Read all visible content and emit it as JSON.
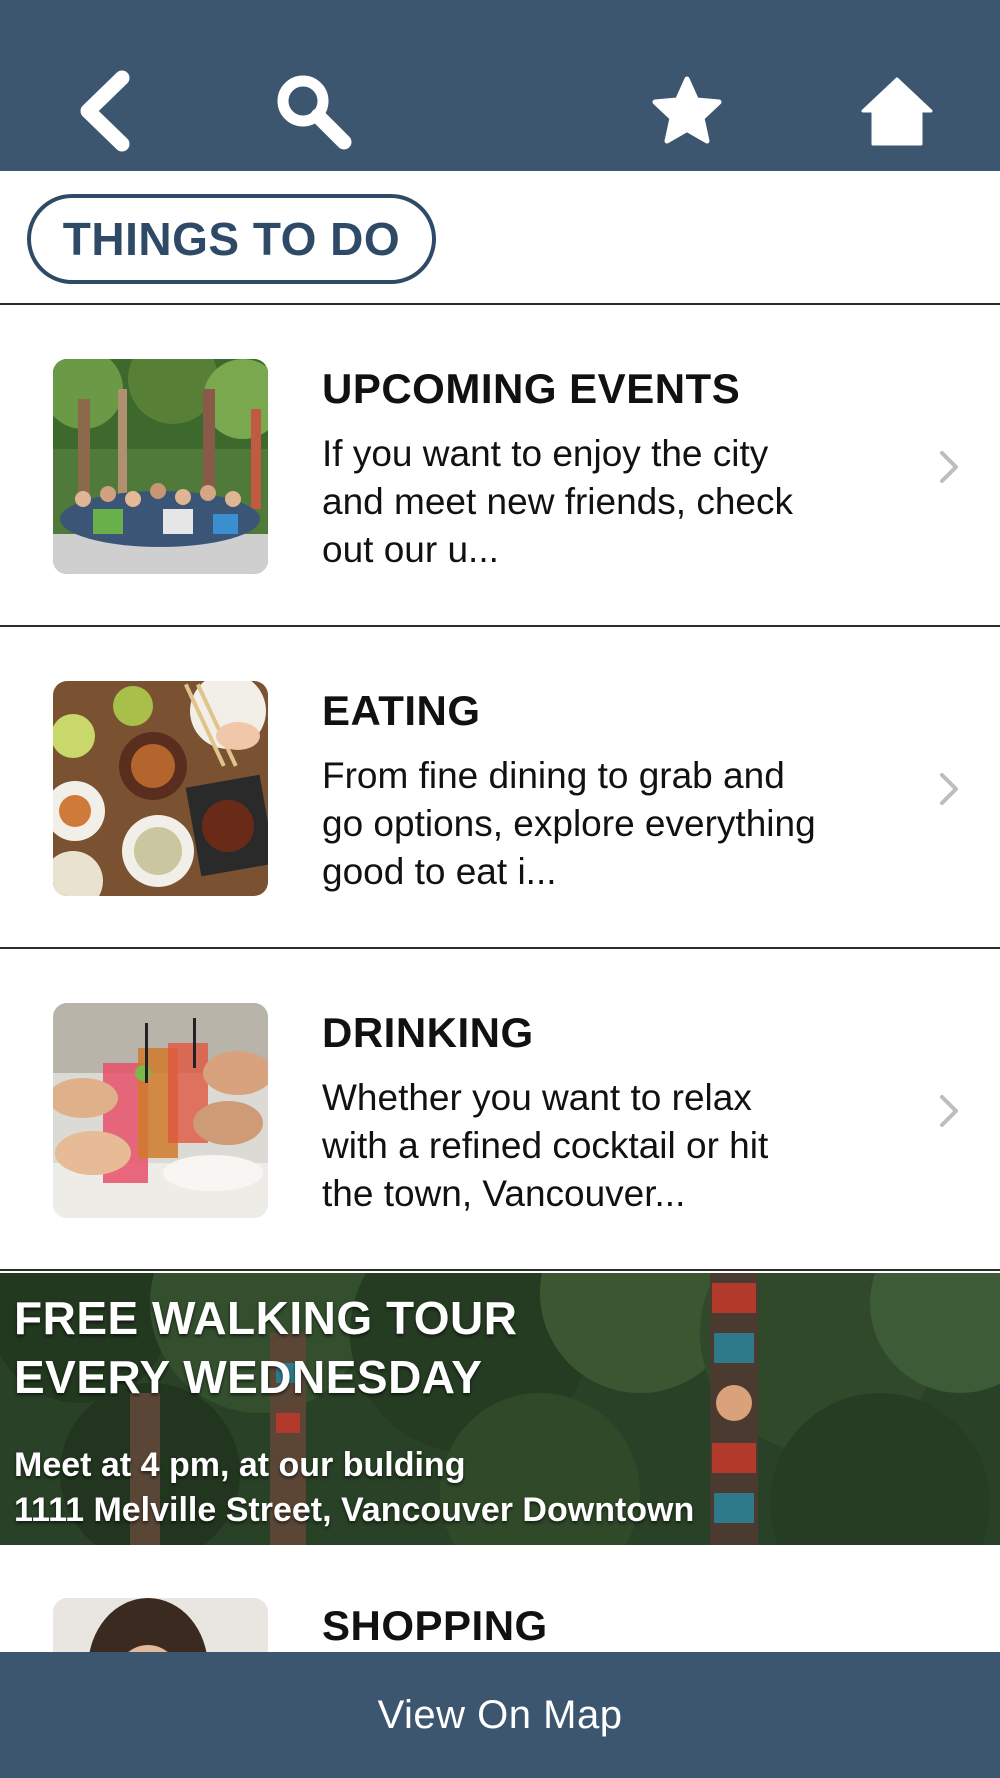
{
  "header": {
    "back_icon": "chevron-left-icon",
    "search_icon": "search-icon",
    "favorites_icon": "star-icon",
    "home_icon": "home-icon",
    "bar_color": "#3d566f"
  },
  "section": {
    "title": "THINGS TO DO",
    "accent_color": "#2e4a66"
  },
  "items": [
    {
      "title": "UPCOMING EVENTS",
      "description": "If you want to enjoy the city and meet new friends, check out our u...",
      "thumbnail": "group-photo-totem-poles"
    },
    {
      "title": "EATING",
      "description": "From fine dining to grab and go options, explore everything good to eat i...",
      "thumbnail": "food-dishes-table"
    },
    {
      "title": "DRINKING",
      "description": "Whether you want to relax with a refined cocktail or hit the town, Vancouver...",
      "thumbnail": "cocktail-glasses-toast"
    },
    {
      "title": "SHOPPING",
      "thumbnail": "woman-portrait"
    }
  ],
  "banner": {
    "line1": "FREE WALKING TOUR",
    "line2": "EVERY WEDNESDAY",
    "line3": "Meet at 4 pm, at our bulding",
    "line4": "1111 Melville Street, Vancouver Downtown",
    "background": "forest-totem-poles"
  },
  "footer": {
    "label": "View On Map"
  }
}
